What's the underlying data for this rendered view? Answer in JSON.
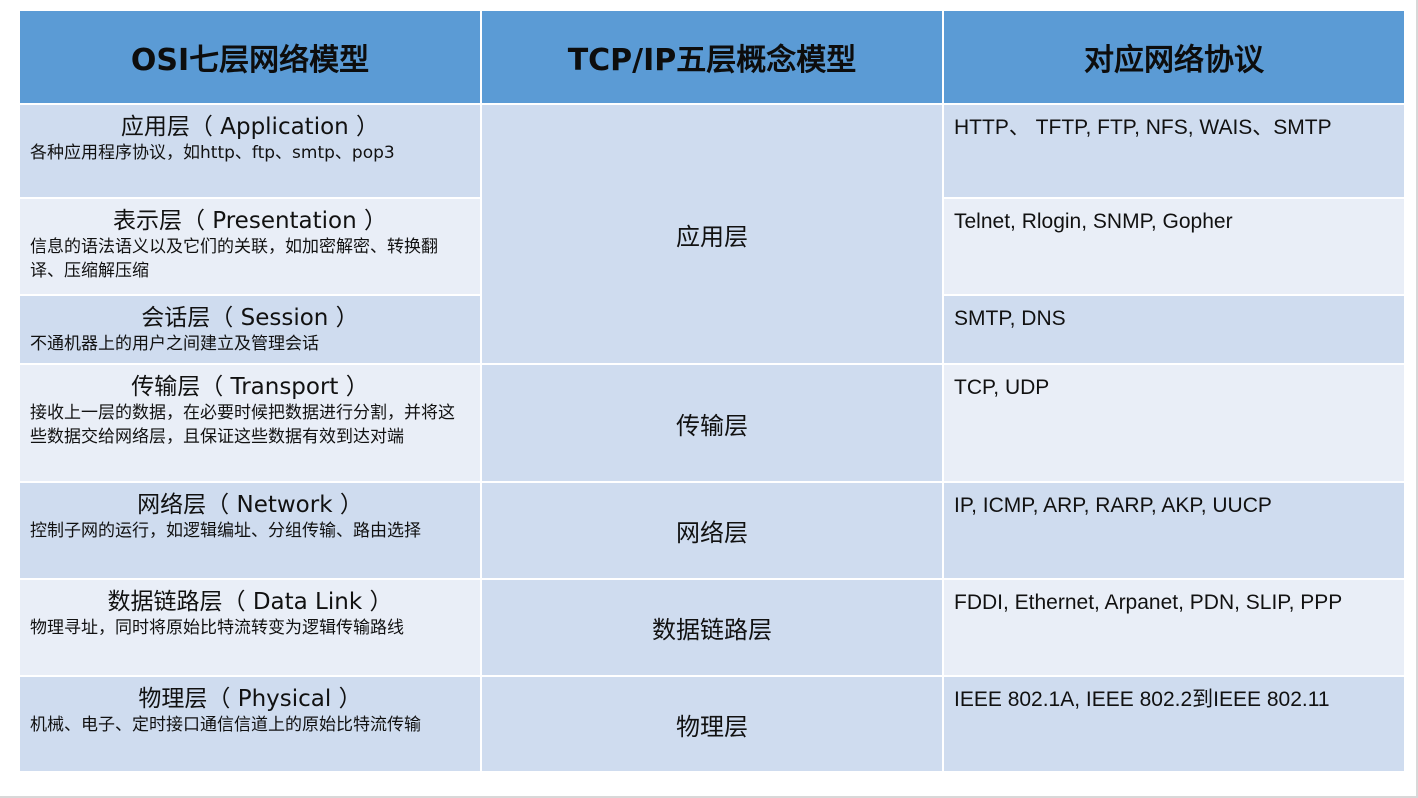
{
  "header": {
    "col1": "OSI七层网络模型",
    "col2": "TCP/IP五层概念模型",
    "col3": "对应网络协议"
  },
  "rows": [
    {
      "osi_title": "应用层（ Application ）",
      "osi_desc": "各种应用程序协议，如http、ftp、smtp、pop3",
      "protocols": "HTTP、 TFTP, FTP, NFS, WAIS、SMTP"
    },
    {
      "osi_title": "表示层（ Presentation ）",
      "osi_desc": "信息的语法语义以及它们的关联，如加密解密、转换翻译、压缩解压缩",
      "protocols": "Telnet, Rlogin, SNMP, Gopher"
    },
    {
      "osi_title": "会话层（ Session ）",
      "osi_desc": "不通机器上的用户之间建立及管理会话",
      "protocols": "SMTP, DNS"
    },
    {
      "osi_title": "传输层（ Transport ）",
      "osi_desc": "接收上一层的数据，在必要时候把数据进行分割，并将这些数据交给网络层，且保证这些数据有效到达对端",
      "protocols": "TCP, UDP"
    },
    {
      "osi_title": "网络层（ Network ）",
      "osi_desc": "控制子网的运行，如逻辑编址、分组传输、路由选择",
      "protocols": "IP, ICMP, ARP, RARP, AKP, UUCP"
    },
    {
      "osi_title": "数据链路层（ Data Link ）",
      "osi_desc": "物理寻址，同时将原始比特流转变为逻辑传输路线",
      "protocols": "FDDI, Ethernet, Arpanet, PDN, SLIP, PPP"
    },
    {
      "osi_title": "物理层（ Physical ）",
      "osi_desc": "机械、电子、定时接口通信信道上的原始比特流传输",
      "protocols": "IEEE 802.1A, IEEE 802.2到IEEE 802.11"
    }
  ],
  "tcp_layers": {
    "application": "应用层",
    "transport": "传输层",
    "network": "网络层",
    "datalink": "数据链路层",
    "physical": "物理层"
  },
  "colors": {
    "header_bg": "#5b9bd5",
    "row_dark": "#cfdcef",
    "row_light": "#e9eef7"
  }
}
